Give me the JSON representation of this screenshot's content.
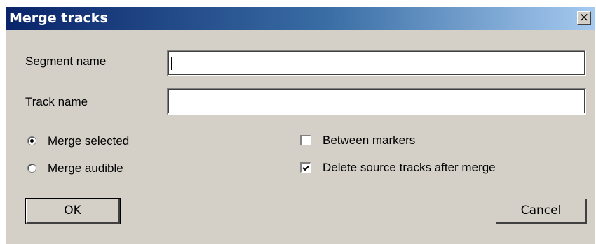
{
  "window": {
    "title": "Merge tracks",
    "close_glyph": "×"
  },
  "fields": {
    "segment_label": "Segment name",
    "segment_value": "",
    "track_label": "Track name",
    "track_value": ""
  },
  "merge_mode": {
    "options": [
      {
        "label": "Merge selected",
        "checked": true
      },
      {
        "label": "Merge audible",
        "checked": false
      }
    ]
  },
  "options": {
    "between_markers": {
      "label": "Between markers",
      "checked": false
    },
    "delete_source": {
      "label": "Delete source tracks after merge",
      "checked": true
    }
  },
  "buttons": {
    "ok": "OK",
    "cancel": "Cancel"
  },
  "colors": {
    "title_bar_start": "#0a246a",
    "title_bar_end": "#a6caf0",
    "dialog_face": "#d4d0c8"
  }
}
